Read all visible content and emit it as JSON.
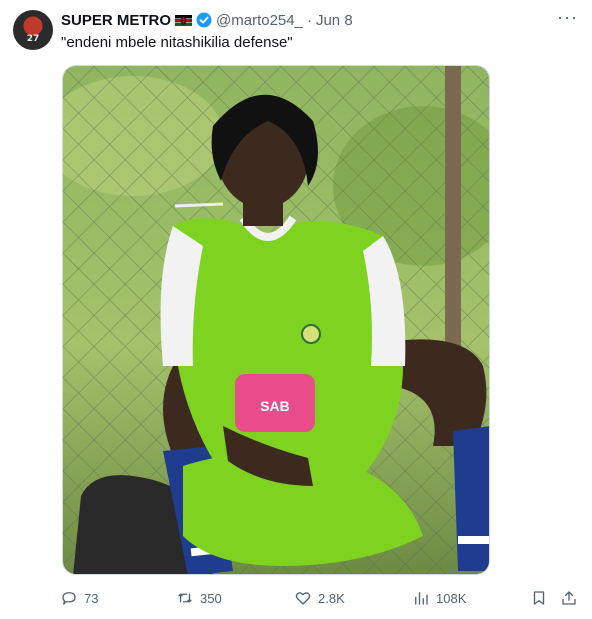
{
  "post": {
    "author_name": "SUPER METRO",
    "author_handle": "@marto254_",
    "separator": "·",
    "date": "Jun 8",
    "text": "\"endeni mbele nitashikilia defense\"",
    "more_label": "···",
    "avatar_label": "27"
  },
  "image": {
    "jersey_badge": "SAB"
  },
  "actions": {
    "replies": "73",
    "reposts": "350",
    "likes": "2.8K",
    "views": "108K"
  },
  "colors": {
    "text": "#0f1419",
    "muted": "#536471",
    "verified": "#1d9bf0",
    "jersey": "#7ed321"
  },
  "icons": [
    "reply-icon",
    "repost-icon",
    "like-icon",
    "views-icon",
    "bookmark-icon",
    "share-icon",
    "verified-badge-icon",
    "kenya-flag-icon",
    "more-icon"
  ]
}
